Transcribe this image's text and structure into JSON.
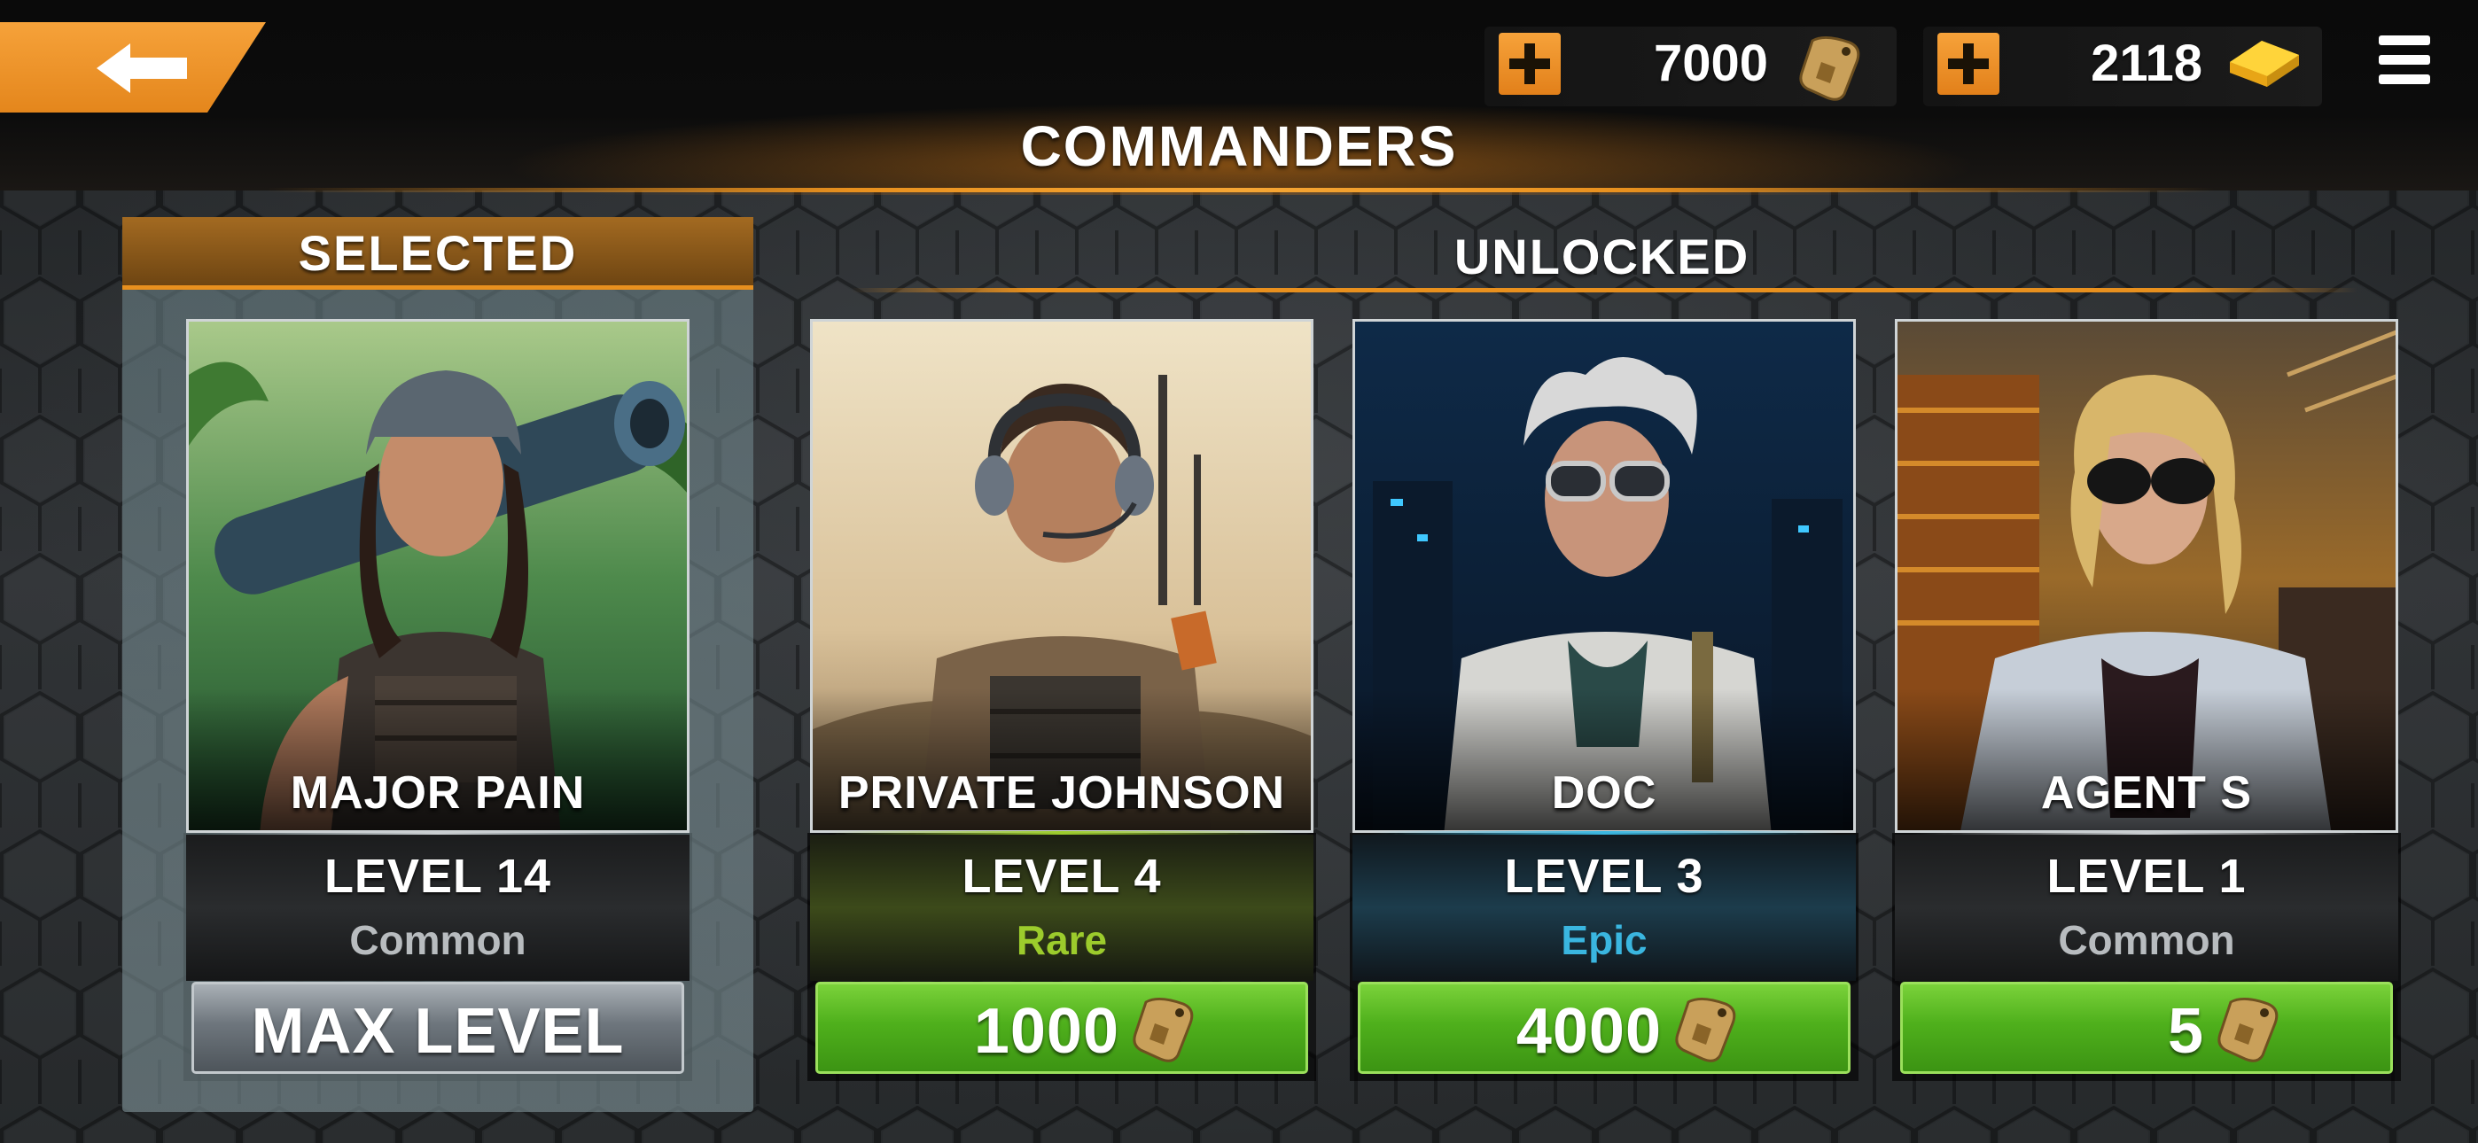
{
  "header": {
    "title": "COMMANDERS",
    "back_icon": "arrow-left-icon",
    "menu_icon": "hamburger-menu-icon"
  },
  "currencies": [
    {
      "name": "dog-tags",
      "amount": "7000",
      "icon": "dog-tag-icon",
      "add_icon": "plus-icon"
    },
    {
      "name": "gold",
      "amount": "2118",
      "icon": "gold-bar-icon",
      "add_icon": "plus-icon"
    }
  ],
  "sections": {
    "selected": "SELECTED",
    "unlocked": "UNLOCKED"
  },
  "commanders": [
    {
      "name": "MAJOR PAIN",
      "level": "LEVEL 14",
      "rarity": "Common",
      "rarity_color": "#b8bcbf",
      "action": "MAX LEVEL",
      "action_style": "grey",
      "selected": true
    },
    {
      "name": "PRIVATE JOHNSON",
      "level": "LEVEL 4",
      "rarity": "Rare",
      "rarity_color": "#9ccc2c",
      "action": "1000",
      "action_style": "green",
      "action_icon": "dog-tag-icon",
      "selected": false
    },
    {
      "name": "DOC",
      "level": "LEVEL 3",
      "rarity": "Epic",
      "rarity_color": "#3ab6e0",
      "action": "4000",
      "action_style": "green",
      "action_icon": "dog-tag-icon",
      "selected": false
    },
    {
      "name": "AGENT S",
      "level": "LEVEL 1",
      "rarity": "Common",
      "rarity_color": "#b8bcbf",
      "action": "5",
      "action_style": "green",
      "action_icon": "dog-tag-icon",
      "selected": false
    }
  ],
  "colors": {
    "accent_orange": "#e8901e",
    "button_green": "#4fb01c",
    "button_grey": "#6e767d"
  }
}
